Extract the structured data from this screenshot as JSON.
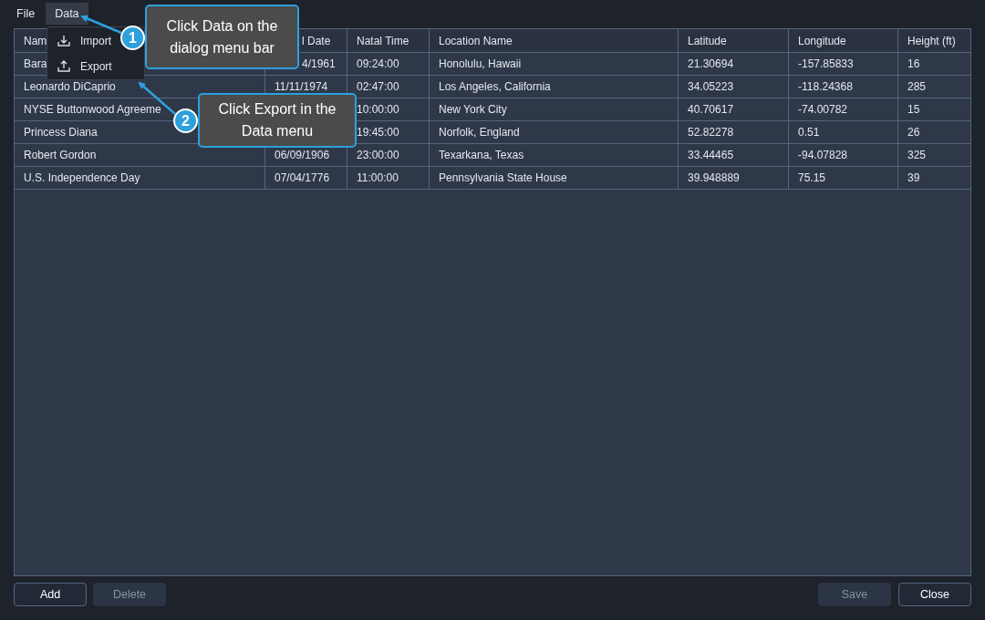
{
  "menu_bar": [
    {
      "label": "File",
      "selected": false
    },
    {
      "label": "Data",
      "selected": true
    }
  ],
  "data_menu": [
    {
      "label": "Import",
      "kind": "import"
    },
    {
      "label": "Export",
      "kind": "export"
    }
  ],
  "table": {
    "columns": [
      "Nam",
      {
        "text": "l Date",
        "clipped": true
      },
      "Natal Time",
      "Location Name",
      "Latitude",
      "Longitude",
      "Height (ft)"
    ],
    "rows": [
      [
        "Bara",
        {
          "text": "4/1961",
          "clipped": true
        },
        "09:24:00",
        "Honolulu, Hawaii",
        "21.30694",
        "-157.85833",
        "16"
      ],
      [
        "Leonardo DiCaprio",
        "11/11/1974",
        "02:47:00",
        "Los Angeles, California",
        "34.05223",
        "-118.24368",
        "285"
      ],
      [
        "NYSE Buttonwood Agreeme",
        null,
        "10:00:00",
        "New York City",
        "40.70617",
        "-74.00782",
        "15"
      ],
      [
        "Princess Diana",
        null,
        "19:45:00",
        "Norfolk, England",
        "52.82278",
        "0.51",
        "26"
      ],
      [
        "Robert Gordon",
        "06/09/1906",
        "23:00:00",
        "Texarkana, Texas",
        "33.44465",
        "-94.07828",
        "325"
      ],
      [
        "U.S. Independence Day",
        "07/04/1776",
        "11:00:00",
        "Pennsylvania State House",
        "39.948889",
        "75.15",
        "39"
      ]
    ]
  },
  "buttons_left": [
    {
      "label": "Add",
      "disabled": false
    },
    {
      "label": "Delete",
      "disabled": true
    }
  ],
  "buttons_right": [
    {
      "label": "Save",
      "disabled": true
    },
    {
      "label": "Close",
      "disabled": false
    }
  ],
  "callouts": [
    {
      "number": "1",
      "text": "Click Data on the dialog menu bar"
    },
    {
      "number": "2",
      "text": "Click Export in the Data menu"
    }
  ]
}
